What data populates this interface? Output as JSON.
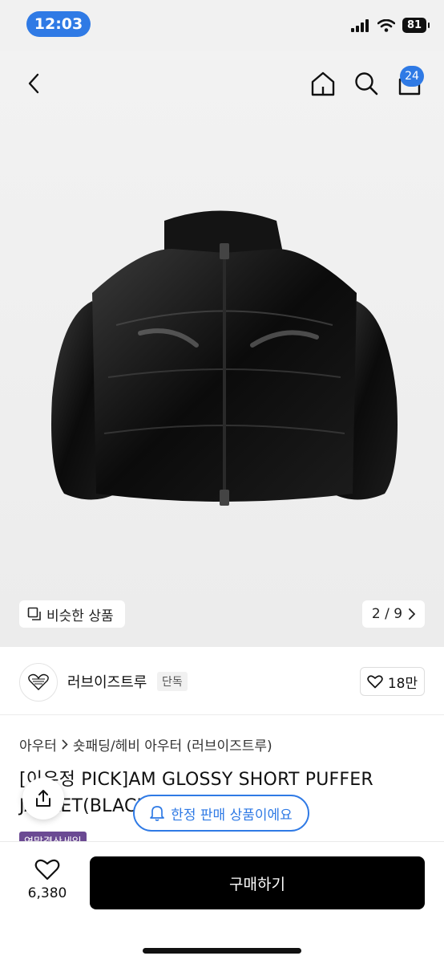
{
  "status_bar": {
    "time": "12:03",
    "battery": "81"
  },
  "nav": {
    "cart_count": "24"
  },
  "gallery": {
    "similar_label": "비슷한 상품",
    "page_indicator": "2 / 9"
  },
  "brand": {
    "name": "러브이즈트루",
    "tag": "단독",
    "logo_text": "LOVE IS TRUE",
    "likes": "18만"
  },
  "breadcrumb": {
    "category": "아우터",
    "subcategory": "숏패딩/헤비 아우터 (러브이즈트루)"
  },
  "product": {
    "title": "[이유정 PICK]AM GLOSSY SHORT PUFFER JACKET(BLACK)",
    "sale_tag": "연말결산세일"
  },
  "floating": {
    "limited_label": "한정 판매 상품이에요"
  },
  "bottom": {
    "wish_count": "6,380",
    "buy_label": "구매하기"
  },
  "colors": {
    "accent": "#2f7ae5",
    "sale_tag": "#6b4a93",
    "buy_button": "#000000"
  }
}
